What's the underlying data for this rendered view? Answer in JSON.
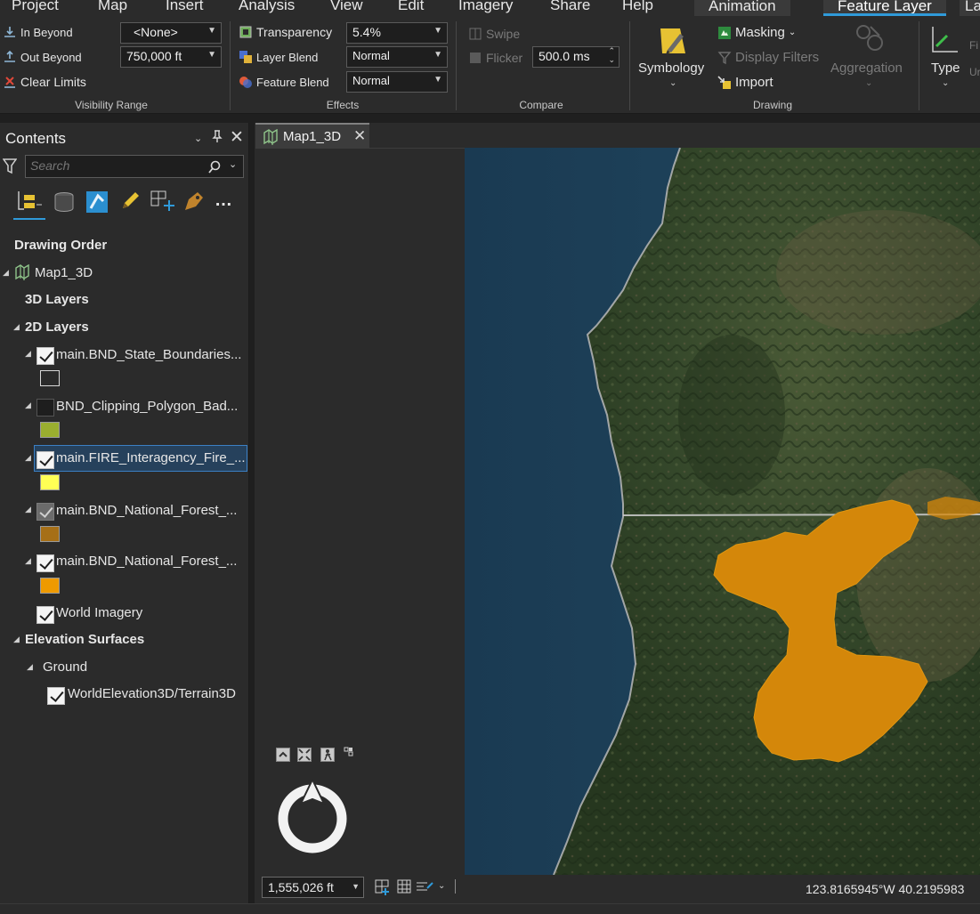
{
  "ribbon_tabs": [
    "Project",
    "Map",
    "Insert",
    "Analysis",
    "View",
    "Edit",
    "Imagery",
    "Share",
    "Help",
    "Animation",
    "Feature Layer",
    "La"
  ],
  "ribbon": {
    "visibility_range": {
      "in_beyond_label": "In Beyond",
      "in_beyond_value": "<None>",
      "out_beyond_label": "Out Beyond",
      "out_beyond_value": "750,000 ft",
      "clear_limits_label": "Clear Limits",
      "group_label": "Visibility Range"
    },
    "effects": {
      "transparency_label": "Transparency",
      "transparency_value": "5.4%",
      "layer_blend_label": "Layer Blend",
      "layer_blend_value": "Normal",
      "feature_blend_label": "Feature Blend",
      "feature_blend_value": "Normal",
      "group_label": "Effects"
    },
    "compare": {
      "swipe_label": "Swipe",
      "flicker_label": "Flicker",
      "flicker_value": "500.0",
      "flicker_unit": "ms",
      "group_label": "Compare"
    },
    "drawing": {
      "symbology_label": "Symbology",
      "masking_label": "Masking",
      "display_filters_label": "Display Filters",
      "import_label": "Import",
      "aggregation_label": "Aggregation",
      "group_label": "Drawing"
    },
    "type_label": "Type",
    "extra_labels": [
      "Fi",
      "Ur"
    ]
  },
  "contents": {
    "title": "Contents",
    "search_placeholder": "Search",
    "drawing_order_label": "Drawing Order",
    "map_name": "Map1_3D",
    "layers_3d_label": "3D Layers",
    "layers_2d_label": "2D Layers",
    "layers": [
      {
        "name": "main.BND_State_Boundaries...",
        "checked": true,
        "swatch": "#2b2b2b"
      },
      {
        "name": "BND_Clipping_Polygon_Bad...",
        "checked": false,
        "swatch": "#9aae2f"
      },
      {
        "name": "main.FIRE_Interagency_Fire_...",
        "checked": true,
        "swatch": "#ffff55"
      },
      {
        "name": "main.BND_National_Forest_...",
        "checked": true,
        "swatch": "#a66f17"
      },
      {
        "name": "main.BND_National_Forest_...",
        "checked": true,
        "swatch": "#ee9a00"
      }
    ],
    "world_imagery_label": "World Imagery",
    "elevation_surfaces_label": "Elevation Surfaces",
    "ground_label": "Ground",
    "terrain_label": "WorldElevation3D/Terrain3D"
  },
  "map": {
    "tab_label": "Map1_3D",
    "scale_value": "1,555,026 ft",
    "coordinates": "123.8165945°W 40.2195983"
  },
  "colors": {
    "fire_polygon": "#d4870a",
    "ocean": "#1d3d56",
    "accent": "#2f9ad9"
  }
}
